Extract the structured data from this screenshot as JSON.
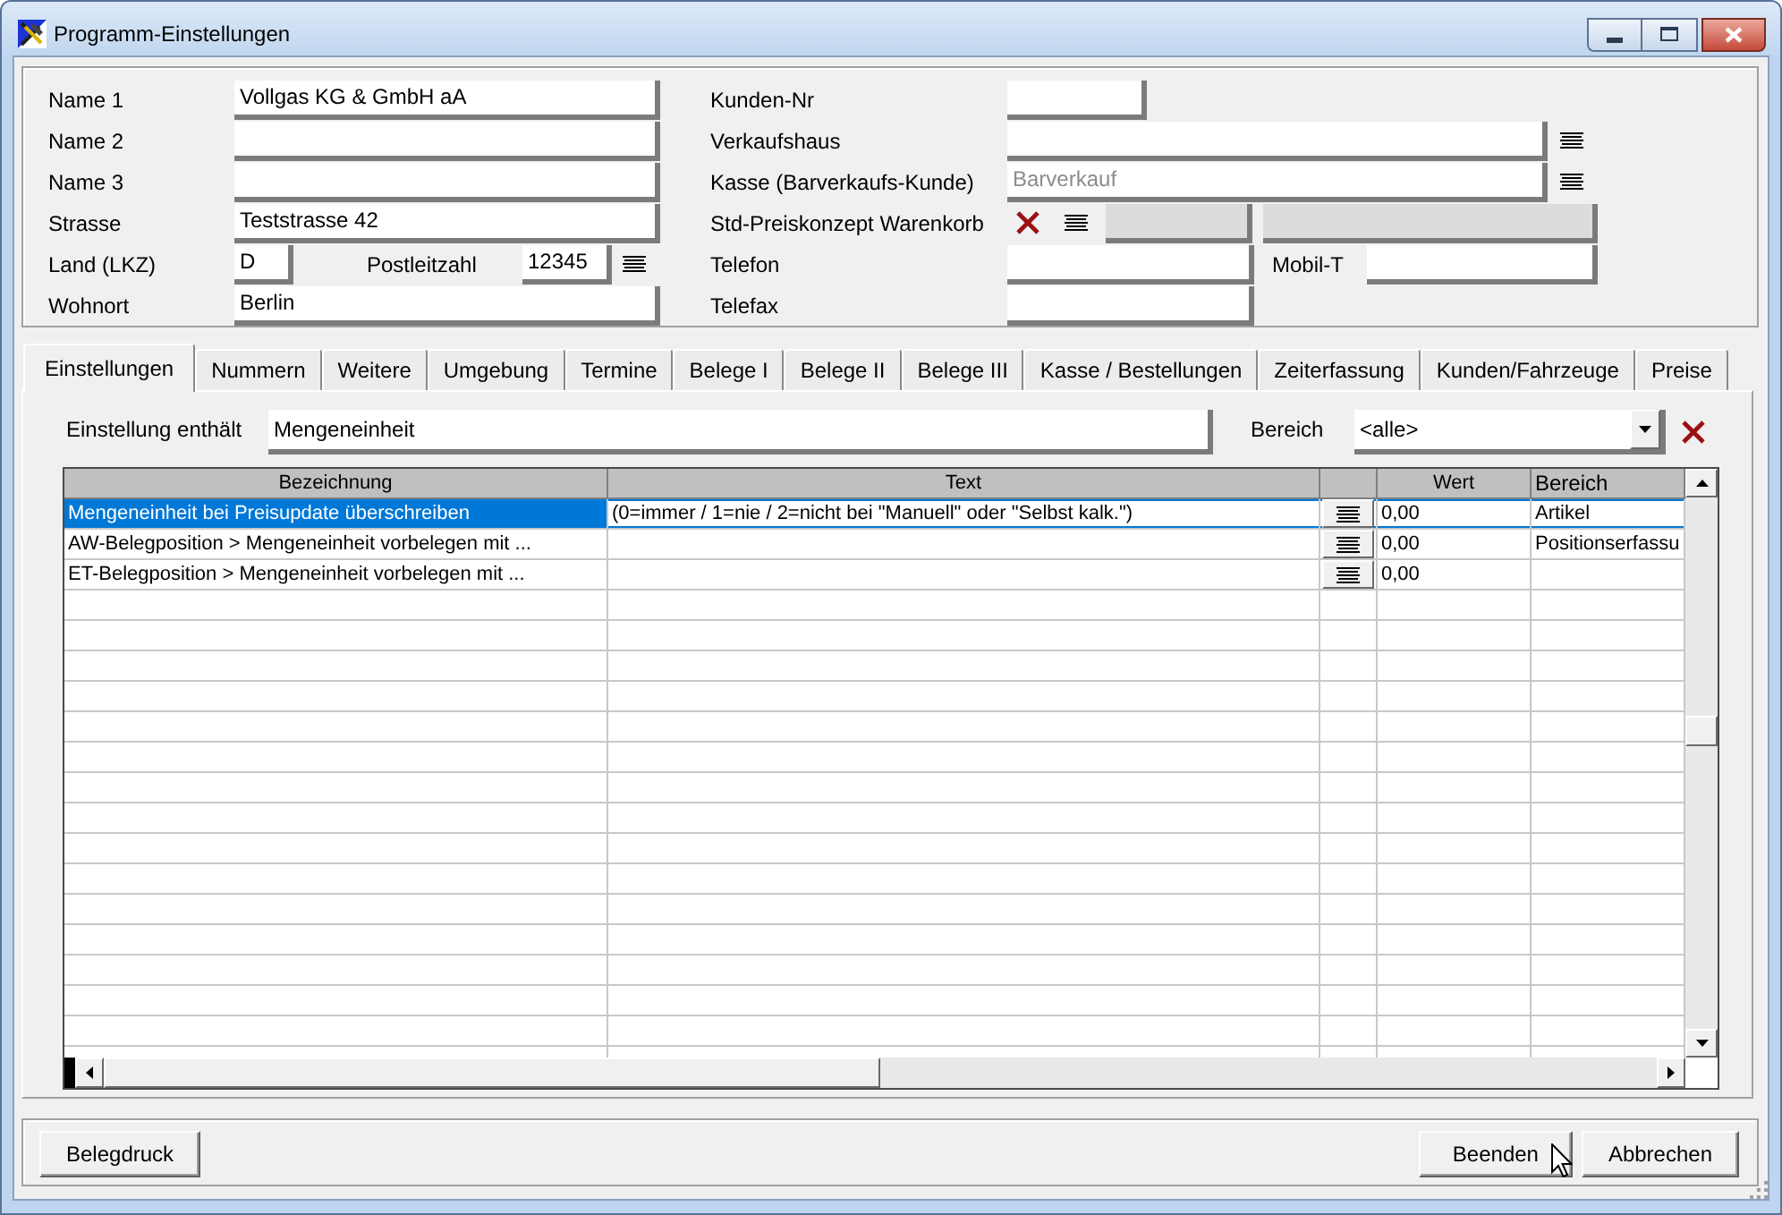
{
  "window": {
    "title": "Programm-Einstellungen"
  },
  "address": {
    "rows": [
      {
        "kind": "text",
        "label": "Name 1",
        "value": "Vollgas KG & GmbH aA"
      },
      {
        "kind": "text",
        "label": "Name 2"
      },
      {
        "kind": "text",
        "label": "Name 3"
      },
      {
        "kind": "text",
        "label": "Strasse",
        "value": "Teststrasse 42"
      },
      {
        "kind": "country_zip",
        "label": "Land (LKZ)",
        "value": "D",
        "zip_label": "Postleitzahl",
        "zip_value": "12345"
      },
      {
        "kind": "text",
        "label": "Wohnort",
        "value": "Berlin"
      }
    ]
  },
  "customer": {
    "rows": [
      {
        "kind": "short",
        "label": "Kunden-Nr"
      },
      {
        "kind": "lookup",
        "label": "Verkaufshaus"
      },
      {
        "kind": "lookup",
        "label": "Kasse (Barverkaufs-Kunde)",
        "placeholder": "Barverkauf"
      },
      {
        "kind": "price_concept",
        "label": "Std-Preiskonzept Warenkorb",
        "disabled": true
      },
      {
        "kind": "pair",
        "label": "Telefon",
        "second_label": "Mobil-T"
      },
      {
        "kind": "medium",
        "label": "Telefax"
      }
    ]
  },
  "tabs": [
    {
      "label": "Einstellungen",
      "selected": true
    },
    {
      "label": "Nummern",
      "selected": false
    },
    {
      "label": "Weitere",
      "selected": false
    },
    {
      "label": "Umgebung",
      "selected": false
    },
    {
      "label": "Termine",
      "selected": false
    },
    {
      "label": "Belege I",
      "selected": false
    },
    {
      "label": "Belege II",
      "selected": false
    },
    {
      "label": "Belege III",
      "selected": false
    },
    {
      "label": "Kasse / Bestellungen",
      "selected": false
    },
    {
      "label": "Zeiterfassung",
      "selected": false
    },
    {
      "label": "Kunden/Fahrzeuge",
      "selected": false
    },
    {
      "label": "Preise",
      "selected": false
    }
  ],
  "filter": {
    "label": "Einstellung enthält",
    "value": "Mengeneinheit"
  },
  "area_filter": {
    "label": "Bereich",
    "value": "<alle>"
  },
  "table": {
    "columns": [
      {
        "kind": "text",
        "label": "Bezeichnung"
      },
      {
        "kind": "text",
        "label": "Text"
      },
      {
        "kind": "button"
      },
      {
        "kind": "text",
        "label": "Wert"
      },
      {
        "kind": "text",
        "label": "Bereich"
      }
    ],
    "rows": [
      {
        "selected": true,
        "bezeichnung": "Mengeneinheit bei Preisupdate überschreiben",
        "text": "(0=immer / 1=nie / 2=nicht bei \"Manuell\" oder \"Selbst kalk.\")",
        "wert": "0,00",
        "bereich": "Artikel"
      },
      {
        "selected": false,
        "bezeichnung": "AW-Belegposition > Mengeneinheit vorbelegen mit ...",
        "wert": "0,00",
        "bereich": "Positionserfassu"
      },
      {
        "selected": false,
        "bezeichnung": "ET-Belegposition > Mengeneinheit vorbelegen mit ...",
        "wert": "0,00"
      }
    ]
  },
  "footer": {
    "left_buttons": [
      "Belegdruck"
    ],
    "right_buttons": [
      "Beenden",
      "Abbrechen"
    ]
  }
}
